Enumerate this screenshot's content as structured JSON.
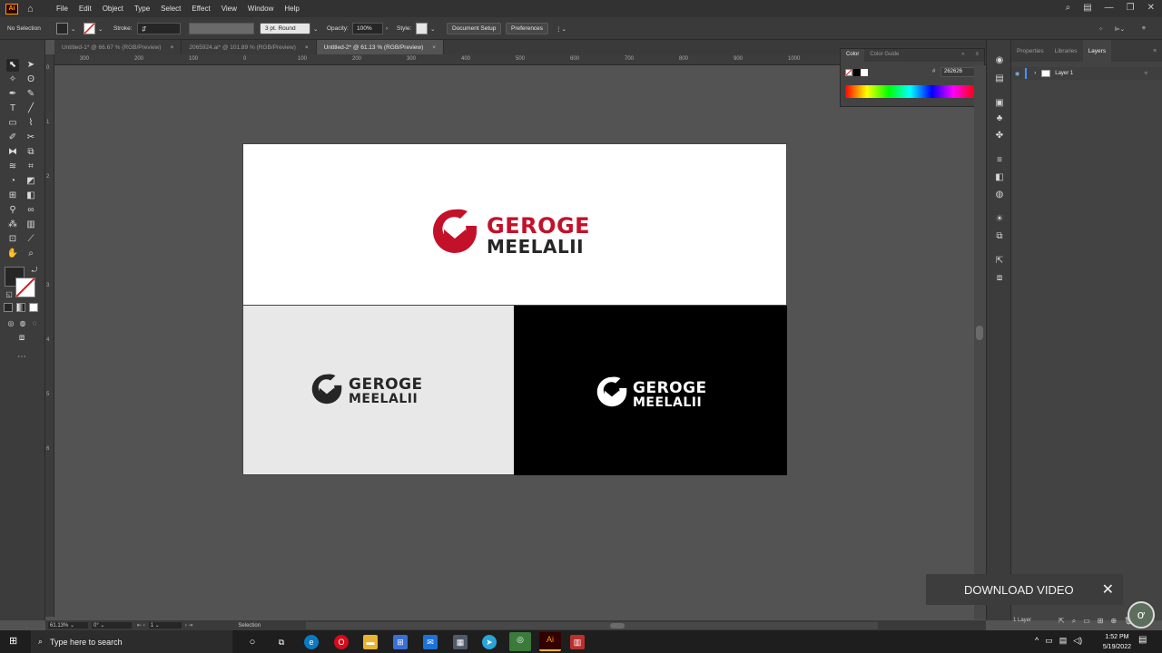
{
  "menubar": {
    "app_logo": "Ai",
    "items": [
      "File",
      "Edit",
      "Object",
      "Type",
      "Select",
      "Effect",
      "View",
      "Window",
      "Help"
    ]
  },
  "controlbar": {
    "selection": "No Selection",
    "stroke_label": "Stroke:",
    "stroke_profile": "3 pt. Round",
    "opacity_label": "Opacity:",
    "opacity_value": "100%",
    "style_label": "Style:",
    "document_setup": "Document Setup",
    "preferences": "Preferences"
  },
  "tabs": [
    {
      "label": "Untitled-1* @ 66.67 % (RGB/Preview)",
      "close": "×"
    },
    {
      "label": "2065924.ai* @ 101.89 % (RGB/Preview)",
      "close": "×"
    },
    {
      "label": "Untitled-2* @ 61.13 % (RGB/Preview)",
      "close": "×"
    }
  ],
  "ruler_top": [
    "300",
    "200",
    "100",
    "0",
    "100",
    "200",
    "300",
    "400",
    "500",
    "600",
    "700",
    "800",
    "900",
    "1000"
  ],
  "ruler_left": [
    "0",
    "1",
    "2",
    "3",
    "4",
    "5",
    "6"
  ],
  "logo": {
    "line1": "GEROGE",
    "line2": "MEELALII",
    "red": "#c3112a",
    "dark": "#262626",
    "white": "#ffffff"
  },
  "color_panel": {
    "tab_color": "Color",
    "tab_guide": "Color Guide",
    "hex_prefix": "#",
    "hex": "262626"
  },
  "layers_panel": {
    "tabs": [
      "Properties",
      "Libraries",
      "Layers"
    ],
    "layer_name": "Layer 1",
    "footer": "1 Layer"
  },
  "statusbar": {
    "zoom": "61.13%",
    "rotation": "0°",
    "artboard": "1",
    "tool": "Selection"
  },
  "overlay": {
    "label": "DOWNLOAD VIDEO",
    "close": "✕"
  },
  "taskbar": {
    "search_placeholder": "Type here to search",
    "time": "1:52 PM",
    "date": "5/19/2022"
  }
}
